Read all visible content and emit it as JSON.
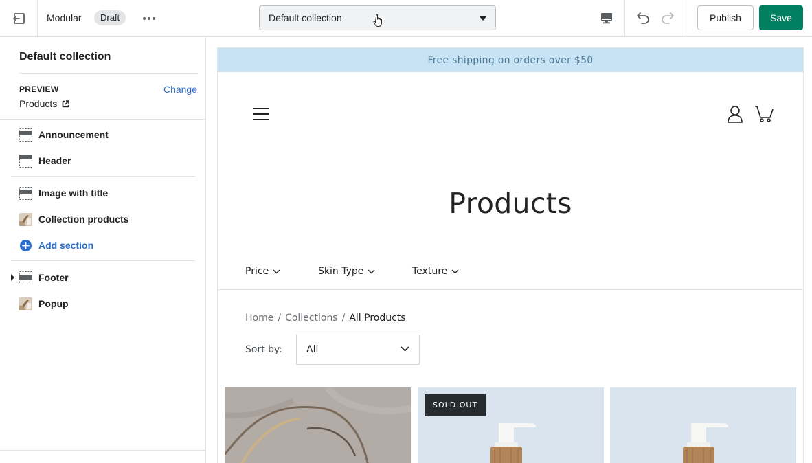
{
  "topbar": {
    "theme_name": "Modular",
    "status_badge": "Draft",
    "template_select": "Default collection",
    "publish_label": "Publish",
    "save_label": "Save",
    "accent_color": "#008060"
  },
  "sidebar": {
    "title": "Default collection",
    "preview_label": "PREVIEW",
    "change_label": "Change",
    "preview_value": "Products",
    "header_group": [
      {
        "label": "Announcement",
        "icon": "section-placeholder-icon"
      },
      {
        "label": "Header",
        "icon": "header-section-icon"
      }
    ],
    "template_group": [
      {
        "label": "Image with title",
        "icon": "section-placeholder-icon"
      },
      {
        "label": "Collection products",
        "icon": "product-thumbnail-icon"
      }
    ],
    "add_section_label": "Add section",
    "footer_group": [
      {
        "label": "Footer",
        "icon": "section-placeholder-icon"
      },
      {
        "label": "Popup",
        "icon": "product-thumbnail-icon"
      }
    ]
  },
  "preview": {
    "announcement": "Free shipping on orders over $50",
    "page_title": "Products",
    "filters": [
      {
        "label": "Price"
      },
      {
        "label": "Skin Type"
      },
      {
        "label": "Texture"
      }
    ],
    "breadcrumb": {
      "home": "Home",
      "collections": "Collections",
      "current": "All Products",
      "separator": "/"
    },
    "sort_label": "Sort by:",
    "sort_value": "All",
    "products": [
      {
        "badge": "",
        "image": "driftwood-photo"
      },
      {
        "badge": "SOLD OUT",
        "image": "pump-bottle-photo"
      },
      {
        "badge": "",
        "image": "pump-bottle-photo"
      }
    ],
    "announcement_bg": "#c8e4f4"
  }
}
